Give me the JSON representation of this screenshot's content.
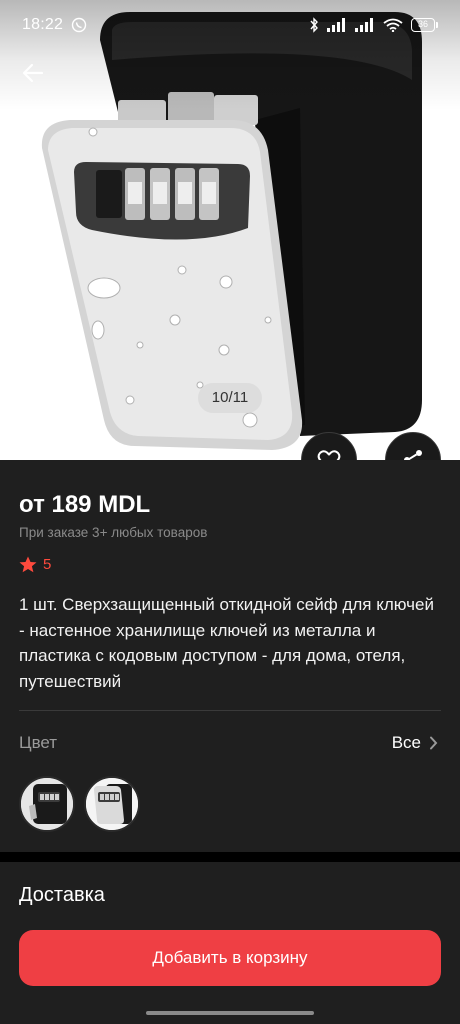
{
  "status_bar": {
    "time": "18:22",
    "battery_level": "36",
    "icons": [
      "viber-icon",
      "bluetooth-icon",
      "signal-icon",
      "signal-icon",
      "wifi-icon",
      "battery-icon"
    ]
  },
  "gallery": {
    "counter": "10/11"
  },
  "product": {
    "price": "от 189 MDL",
    "price_note": "При заказе 3+ любых товаров",
    "rating": "5",
    "title": "1 шт. Сверхзащищенный откидной сейф для ключей - настенное хранилище ключей из металла и пластика с кодовым доступом - для дома, отеля, путешествий"
  },
  "color_section": {
    "label": "Цвет",
    "all_label": "Все"
  },
  "delivery": {
    "title": "Доставка"
  },
  "actions": {
    "add_to_cart": "Добавить в корзину"
  },
  "colors": {
    "accent": "#ef3f44",
    "rating_star": "#ff4a3d",
    "panel_bg": "#1f1f1f"
  }
}
